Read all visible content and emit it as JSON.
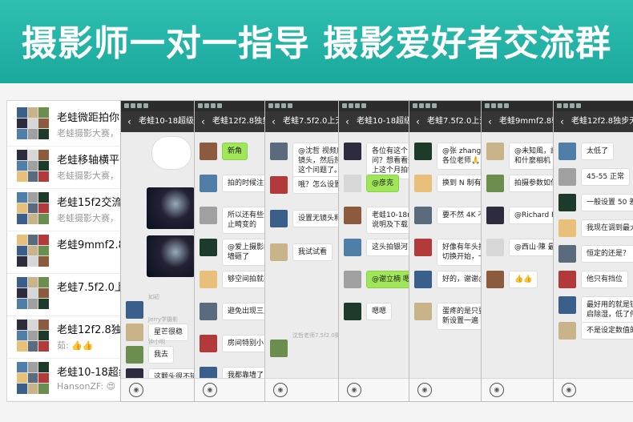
{
  "banner": {
    "title": "摄影师一对一指导  摄影爱好者交流群"
  },
  "chat_list": [
    {
      "name": "老蛙微距拍你",
      "preview": "老蛙摄影大赛，"
    },
    {
      "name": "老蛙移轴横平",
      "preview": "老蛙摄影大赛，"
    },
    {
      "name": "老蛙15f2交流",
      "preview": "老蛙摄影大赛，"
    },
    {
      "name": "老蛙9mmf2.8",
      "preview": ""
    },
    {
      "name": "老蛙7.5f2.0上",
      "preview": ""
    },
    {
      "name": "老蛙12f2.8独",
      "preview": "茹: 👍👍"
    },
    {
      "name": "老蛙10-18超纟",
      "preview": "HansonZF: 😍"
    }
  ],
  "phones": [
    {
      "title": "老蛙10-18超级视野",
      "messages": [
        {
          "sender": "如初",
          "text": ""
        },
        {
          "sender": "Jerry学摄影",
          "text": "星芒很稳"
        },
        {
          "sender": "钟小明",
          "text": "我去"
        },
        {
          "sender": "",
          "text": "这颗头很不错"
        }
      ]
    },
    {
      "title": "老蛙12f2.8独步天下",
      "messages": [
        {
          "sender": "",
          "text": "新角",
          "me": true
        },
        {
          "sender": "",
          "text": "拍的时候注意进"
        },
        {
          "sender": "",
          "text": "所以还有些涉嫌\n止畸变的"
        },
        {
          "sender": "",
          "text": "@爱上摄影的梓\n墙砸了"
        },
        {
          "sender": "",
          "text": "够空间拍就不会"
        },
        {
          "sender": "",
          "text": "避免出现三点进"
        },
        {
          "sender": "",
          "text": "房间特别小"
        },
        {
          "sender": "",
          "text": "我都靠墙了"
        }
      ]
    },
    {
      "title": "老蛙7.5f2.0上天入地",
      "messages": [
        {
          "sender": "",
          "text": "@沈哲 视频后期\n镜头，然后热机\n这个问题了。"
        },
        {
          "sender": "",
          "text": "哦？怎么设置无"
        },
        {
          "sender": "",
          "text": "设置无镜头释放"
        },
        {
          "sender": "",
          "text": "我试试看"
        },
        {
          "sender": "沈哲老师7.5f2.0微博",
          "text": ""
        }
      ]
    },
    {
      "title": "老蛙10-18超级视野",
      "messages": [
        {
          "sender": "",
          "text": "各位有这个 10-\n问？想看看效果\n上这个月拍银河"
        },
        {
          "sender": "",
          "text": "@彦克",
          "me": true
        },
        {
          "sender": "",
          "text": "老蛙10-18mm 镜\n说明及下载"
        },
        {
          "sender": "",
          "text": "这头拍银河，"
        },
        {
          "sender": "",
          "text": "@谢立楠 嗯，那",
          "me": true
        },
        {
          "sender": "",
          "text": "嗯嗯"
        }
      ]
    },
    {
      "title": "老蛙7.5f2.0上天入地",
      "messages": [
        {
          "sender": "",
          "text": "@张 zhang 好的\n各位老师🙏"
        },
        {
          "sender": "",
          "text": "换到 N 制有时候"
        },
        {
          "sender": "",
          "text": "要不然 4K 不能"
        },
        {
          "sender": "",
          "text": "好像有年头拍\n切换开始，一直"
        },
        {
          "sender": "",
          "text": "好的，谢谢@张"
        },
        {
          "sender": "",
          "text": "蛋疼的是只要重\n新设置一遍"
        }
      ]
    },
    {
      "title": "老蛙9mmf2.8轻轻",
      "messages": [
        {
          "sender": "",
          "text": "@未知風，請問\n和什麼相机"
        },
        {
          "sender": "",
          "text": "拍摄参数如何？"
        },
        {
          "sender": "",
          "text": "@Richard Foo"
        },
        {
          "sender": "",
          "text": "@西山·陳 最大"
        },
        {
          "sender": "",
          "text": "👍👍"
        }
      ]
    },
    {
      "title": "老蛙12f2.8独步天入",
      "messages": [
        {
          "sender": "",
          "text": "太低了"
        },
        {
          "sender": "",
          "text": "45-55 正常"
        },
        {
          "sender": "",
          "text": "一般设置 50 差不"
        },
        {
          "sender": "",
          "text": "我现在调到最大"
        },
        {
          "sender": "",
          "text": "恒定的还是？"
        },
        {
          "sender": "",
          "text": "他只有挡位"
        },
        {
          "sender": "",
          "text": "最好用的就是锐\n启除湿，低了停"
        },
        {
          "sender": "",
          "text": "不是设定数值的"
        }
      ]
    }
  ]
}
